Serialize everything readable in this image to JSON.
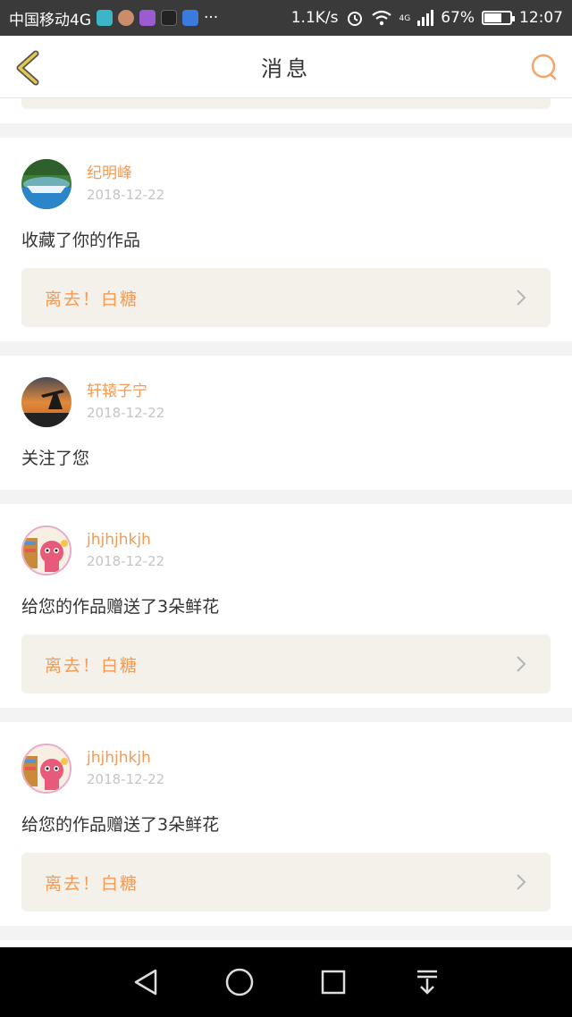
{
  "status_bar": {
    "carrier": "中国移动4G",
    "more": "···",
    "speed": "1.1K/s",
    "network": "4G",
    "battery": "67%",
    "battery_level": 0.67,
    "time": "12:07",
    "icons": [
      "alarm-icon",
      "wifi-icon",
      "signal-icon",
      "battery-icon"
    ]
  },
  "header": {
    "title": "消息",
    "back_icon": "back-chevron-icon",
    "search_icon": "search-icon"
  },
  "messages": [
    {
      "username": "纪明峰",
      "date": "2018-12-22",
      "action": "收藏了你的作品",
      "work_title": "离去！白糖",
      "avatar": "avatar-waterfall"
    },
    {
      "username": "轩辕子宁",
      "date": "2018-12-22",
      "action": "关注了您",
      "work_title": null,
      "avatar": "avatar-sunset-oilrig"
    },
    {
      "username": "jhjhjhkjh",
      "date": "2018-12-22",
      "action": "给您的作品赠送了3朵鲜花",
      "work_title": "离去！白糖",
      "avatar": "avatar-cartoon-cat"
    },
    {
      "username": "jhjhjhkjh",
      "date": "2018-12-22",
      "action": "给您的作品赠送了3朵鲜花",
      "work_title": "离去！白糖",
      "avatar": "avatar-cartoon-cat"
    }
  ],
  "colors": {
    "accent": "#f39a55",
    "date": "#c4c4c4",
    "work_bg": "#f3f1ea",
    "back_icon": "#e6c84a"
  },
  "nav_bar": [
    "back-triangle-icon",
    "home-circle-icon",
    "recents-square-icon",
    "notification-pull-icon"
  ]
}
